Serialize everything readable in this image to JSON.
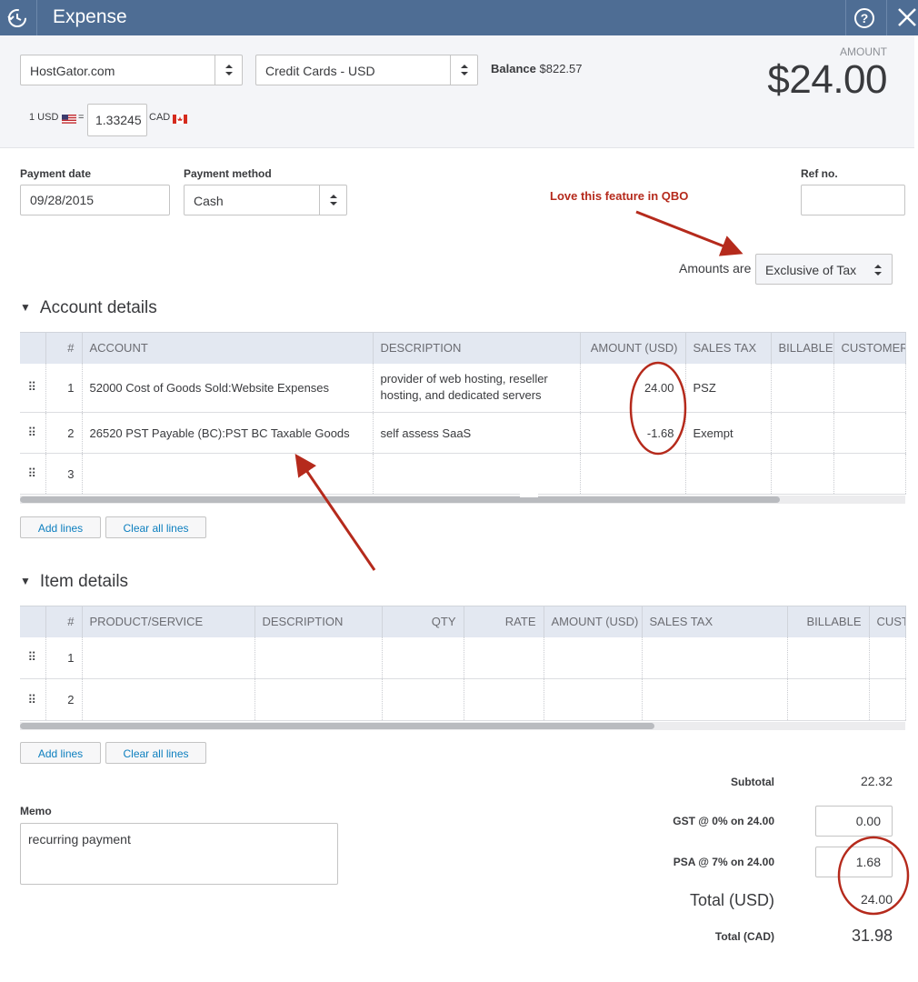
{
  "titlebar": {
    "title": "Expense"
  },
  "header": {
    "payee": "HostGator.com",
    "account": "Credit Cards - USD",
    "balance_label": "Balance",
    "balance_value": "$822.57",
    "amount_label": "AMOUNT",
    "amount_value": "$24.00",
    "rate_prefix": "1 USD",
    "rate_eq": "=",
    "rate_value": "1.33245",
    "rate_suffix": "CAD"
  },
  "fields": {
    "payment_date_label": "Payment date",
    "payment_date": "09/28/2015",
    "payment_method_label": "Payment method",
    "payment_method": "Cash",
    "ref_no_label": "Ref no.",
    "ref_no": ""
  },
  "annotation": "Love this feature in QBO",
  "amounts_are": {
    "label": "Amounts are",
    "value": "Exclusive of Tax"
  },
  "account_details": {
    "title": "Account details",
    "columns": [
      "#",
      "ACCOUNT",
      "DESCRIPTION",
      "AMOUNT (USD)",
      "SALES TAX",
      "BILLABLE",
      "CUSTOMER"
    ],
    "rows": [
      {
        "num": "1",
        "account": "52000 Cost of Goods Sold:Website Expenses",
        "description": "provider of web hosting, reseller hosting, and dedicated servers",
        "amount": "24.00",
        "tax": "PSZ"
      },
      {
        "num": "2",
        "account": "26520 PST Payable (BC):PST BC Taxable Goods",
        "description": "self assess SaaS",
        "amount": "-1.68",
        "tax": "Exempt"
      },
      {
        "num": "3",
        "account": "",
        "description": "",
        "amount": "",
        "tax": ""
      }
    ],
    "add_lines": "Add lines",
    "clear_lines": "Clear all lines"
  },
  "item_details": {
    "title": "Item details",
    "columns": [
      "#",
      "PRODUCT/SERVICE",
      "DESCRIPTION",
      "QTY",
      "RATE",
      "AMOUNT (USD)",
      "SALES TAX",
      "BILLABLE",
      "CUST"
    ],
    "rows": [
      {
        "num": "1"
      },
      {
        "num": "2"
      }
    ],
    "add_lines": "Add lines",
    "clear_lines": "Clear all lines"
  },
  "memo": {
    "label": "Memo",
    "value": "recurring payment"
  },
  "totals": {
    "subtotal_label": "Subtotal",
    "subtotal": "22.32",
    "gst_label": "GST @ 0% on 24.00",
    "gst": "0.00",
    "psa_label": "PSA @ 7% on 24.00",
    "psa": "1.68",
    "total_usd_label": "Total (USD)",
    "total_usd": "24.00",
    "total_cad_label": "Total (CAD)",
    "total_cad": "31.98"
  },
  "colors": {
    "titlebar": "#4e6d94",
    "annotation": "#b52a1c",
    "link": "#0d7fbf"
  }
}
